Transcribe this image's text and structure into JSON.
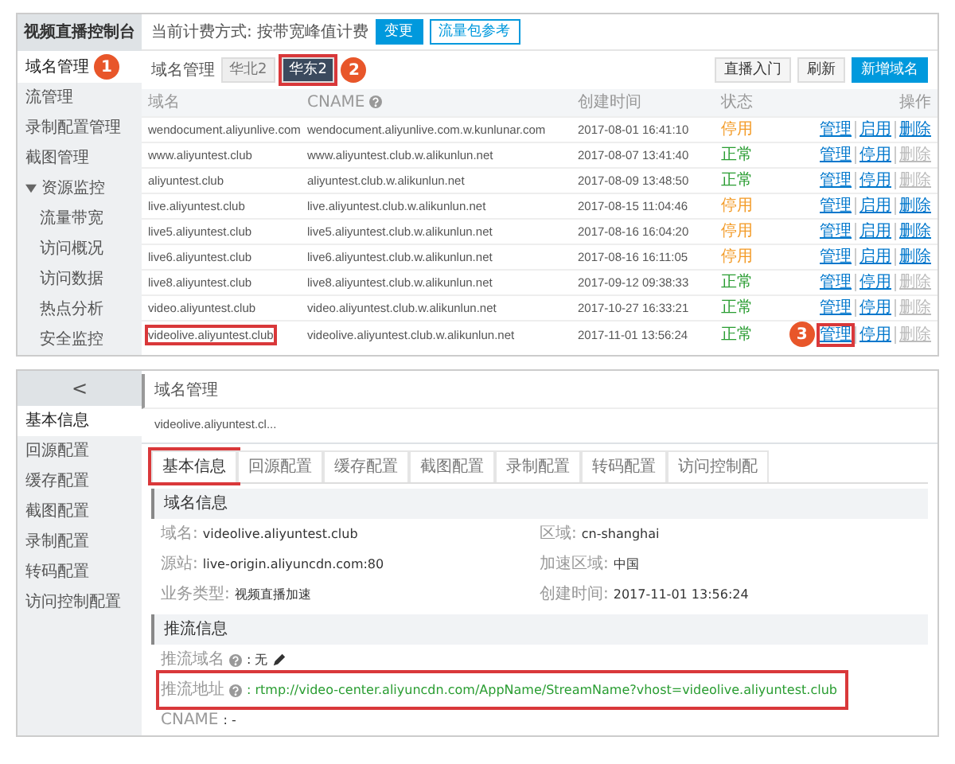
{
  "console": {
    "sidebar": {
      "title": "视频直播控制台",
      "items": [
        {
          "label": "域名管理",
          "selected": true,
          "callout": "1"
        },
        {
          "label": "流管理",
          "selected": false
        },
        {
          "label": "录制配置管理",
          "selected": false
        },
        {
          "label": "截图管理",
          "selected": false
        },
        {
          "label": "资源监控",
          "selected": false,
          "expanded": true,
          "children": [
            {
              "label": "流量带宽",
              "selected": false
            },
            {
              "label": "访问概况",
              "selected": false
            },
            {
              "label": "访问数据",
              "selected": false
            },
            {
              "label": "热点分析",
              "selected": false
            },
            {
              "label": "安全监控",
              "selected": false
            }
          ]
        }
      ]
    },
    "billing": {
      "label": "当前计费方式: 按带宽峰值计费",
      "buttons": [
        {
          "label": "变更",
          "kind": "primary"
        },
        {
          "label": "流量包参考",
          "kind": "outline"
        }
      ]
    },
    "region_bar": {
      "label": "域名管理",
      "tabs": [
        {
          "label": "华北2",
          "selected": false
        },
        {
          "label": "华东2",
          "selected": true,
          "outlined": true,
          "callout": "2"
        }
      ]
    },
    "actions": [
      {
        "label": "直播入门",
        "kind": "light"
      },
      {
        "label": "刷新",
        "kind": "light"
      },
      {
        "label": "新增域名",
        "kind": "primary"
      }
    ],
    "table": {
      "columns": [
        {
          "label": "域名"
        },
        {
          "label": "CNAME",
          "help": true
        },
        {
          "label": "创建时间"
        },
        {
          "label": "状态"
        },
        {
          "label": "操作"
        }
      ],
      "rows": [
        {
          "domain": "wendocument.aliyunlive.com",
          "cname": "wendocument.aliyunlive.com.w.kunlunar.com",
          "created": "2017-08-01 16:41:10",
          "status": {
            "label": "停用",
            "kind": "stopped"
          },
          "ops": [
            {
              "label": "管理",
              "disabled": false
            },
            {
              "label": "启用",
              "disabled": false
            },
            {
              "label": "删除",
              "disabled": false
            }
          ]
        },
        {
          "domain": "www.aliyuntest.club",
          "cname": "www.aliyuntest.club.w.alikunlun.net",
          "created": "2017-08-07 13:41:40",
          "status": {
            "label": "正常",
            "kind": "normal"
          },
          "ops": [
            {
              "label": "管理",
              "disabled": false
            },
            {
              "label": "停用",
              "disabled": false
            },
            {
              "label": "删除",
              "disabled": true
            }
          ]
        },
        {
          "domain": "aliyuntest.club",
          "cname": "aliyuntest.club.w.alikunlun.net",
          "created": "2017-08-09 13:48:50",
          "status": {
            "label": "正常",
            "kind": "normal"
          },
          "ops": [
            {
              "label": "管理",
              "disabled": false
            },
            {
              "label": "停用",
              "disabled": false
            },
            {
              "label": "删除",
              "disabled": true
            }
          ]
        },
        {
          "domain": "live.aliyuntest.club",
          "cname": "live.aliyuntest.club.w.alikunlun.net",
          "created": "2017-08-15 11:04:46",
          "status": {
            "label": "停用",
            "kind": "stopped"
          },
          "ops": [
            {
              "label": "管理",
              "disabled": false
            },
            {
              "label": "启用",
              "disabled": false
            },
            {
              "label": "删除",
              "disabled": false
            }
          ]
        },
        {
          "domain": "live5.aliyuntest.club",
          "cname": "live5.aliyuntest.club.w.alikunlun.net",
          "created": "2017-08-16 16:04:20",
          "status": {
            "label": "停用",
            "kind": "stopped"
          },
          "ops": [
            {
              "label": "管理",
              "disabled": false
            },
            {
              "label": "启用",
              "disabled": false
            },
            {
              "label": "删除",
              "disabled": false
            }
          ]
        },
        {
          "domain": "live6.aliyuntest.club",
          "cname": "live6.aliyuntest.club.w.alikunlun.net",
          "created": "2017-08-16 16:11:05",
          "status": {
            "label": "停用",
            "kind": "stopped"
          },
          "ops": [
            {
              "label": "管理",
              "disabled": false
            },
            {
              "label": "启用",
              "disabled": false
            },
            {
              "label": "删除",
              "disabled": false
            }
          ]
        },
        {
          "domain": "live8.aliyuntest.club",
          "cname": "live8.aliyuntest.club.w.alikunlun.net",
          "created": "2017-09-12 09:38:33",
          "status": {
            "label": "正常",
            "kind": "normal"
          },
          "ops": [
            {
              "label": "管理",
              "disabled": false
            },
            {
              "label": "停用",
              "disabled": false
            },
            {
              "label": "删除",
              "disabled": true
            }
          ]
        },
        {
          "domain": "video.aliyuntest.club",
          "cname": "video.aliyuntest.club.w.alikunlun.net",
          "created": "2017-10-27 16:33:21",
          "status": {
            "label": "正常",
            "kind": "normal"
          },
          "ops": [
            {
              "label": "管理",
              "disabled": false
            },
            {
              "label": "停用",
              "disabled": false
            },
            {
              "label": "删除",
              "disabled": true
            }
          ]
        },
        {
          "domain": "videolive.aliyuntest.club",
          "outlined": true,
          "cname": "videolive.aliyuntest.club.w.alikunlun.net",
          "created": "2017-11-01 13:56:24",
          "status": {
            "label": "正常",
            "kind": "normal"
          },
          "ops": [
            {
              "label": "管理",
              "disabled": false,
              "outlined": true,
              "callout": "3"
            },
            {
              "label": "停用",
              "disabled": false
            },
            {
              "label": "删除",
              "disabled": true
            }
          ]
        }
      ]
    }
  },
  "domain_config": {
    "back": "<",
    "sidebar": [
      {
        "label": "基本信息",
        "selected": true
      },
      {
        "label": "回源配置",
        "selected": false
      },
      {
        "label": "缓存配置",
        "selected": false
      },
      {
        "label": "截图配置",
        "selected": false
      },
      {
        "label": "录制配置",
        "selected": false
      },
      {
        "label": "转码配置",
        "selected": false
      },
      {
        "label": "访问控制配置",
        "selected": false
      }
    ],
    "title": "域名管理",
    "domain": "videolive.aliyuntest.cl...",
    "tabs": [
      {
        "label": "基本信息",
        "selected": true,
        "outlined": true
      },
      {
        "label": "回源配置",
        "selected": false
      },
      {
        "label": "缓存配置",
        "selected": false
      },
      {
        "label": "截图配置",
        "selected": false
      },
      {
        "label": "录制配置",
        "selected": false
      },
      {
        "label": "转码配置",
        "selected": false
      },
      {
        "label": "访问控制配",
        "selected": false
      }
    ],
    "sections": [
      {
        "title": "域名信息",
        "fields": [
          {
            "label": "域名:",
            "value": "videolive.aliyuntest.club"
          },
          {
            "label": "区域:",
            "value": "cn-shanghai"
          },
          {
            "label": "源站:",
            "value": "live-origin.aliyuncdn.com:80"
          },
          {
            "label": "加速区域:",
            "value": "中国"
          },
          {
            "label": "业务类型:",
            "value": "视频直播加速"
          },
          {
            "label": "创建时间:",
            "value": "2017-11-01 13:56:24"
          }
        ]
      },
      {
        "title": "推流信息",
        "fields": [
          {
            "label": "推流域名",
            "help": true,
            "value": ": 无",
            "editable": true
          },
          {
            "label": "推流地址",
            "help": true,
            "outlined": true,
            "value": ": rtmp://video-center.aliyuncdn.com/AppName/StreamName?vhost=videolive.aliyuntest.club",
            "kind": "link"
          },
          {
            "label": "CNAME",
            "value": ": -"
          }
        ]
      }
    ]
  }
}
